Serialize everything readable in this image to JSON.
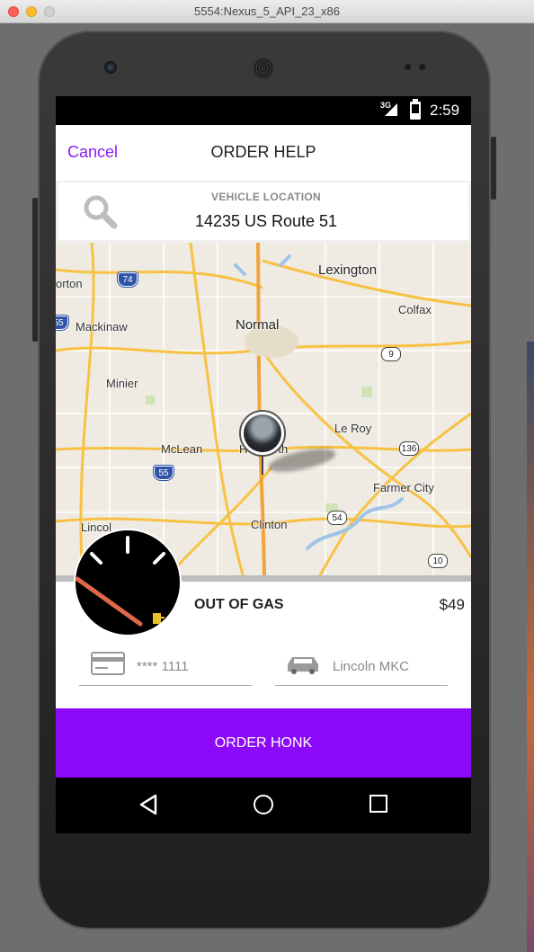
{
  "window": {
    "title": "5554:Nexus_5_API_23_x86"
  },
  "status_bar": {
    "network": "3G",
    "time": "2:59"
  },
  "header": {
    "cancel_label": "Cancel",
    "title": "ORDER HELP"
  },
  "location": {
    "label": "VEHICLE LOCATION",
    "value": "14235 US Route 51"
  },
  "map": {
    "places": [
      "Lexington",
      "orton",
      "Colfax",
      "Mackinaw",
      "Normal",
      "Minier",
      "Le Roy",
      "McLean",
      "He",
      "rth",
      "Farmer City",
      "Lincol",
      "Clinton"
    ],
    "routes": [
      "74",
      "55",
      "9",
      "136",
      "55",
      "54",
      "10"
    ],
    "pin_icon": "car-photo-pin"
  },
  "service": {
    "name": "OUT OF GAS",
    "price": "$49",
    "gauge_icon": "fuel-gauge-icon"
  },
  "payment": {
    "card": "**** 1111",
    "icon": "credit-card-icon"
  },
  "vehicle": {
    "name": "Lincoln MKC",
    "icon": "car-icon"
  },
  "order_button": {
    "label": "ORDER HONK",
    "color": "#8b0af7"
  },
  "colors": {
    "accent": "#8a1cf2"
  }
}
